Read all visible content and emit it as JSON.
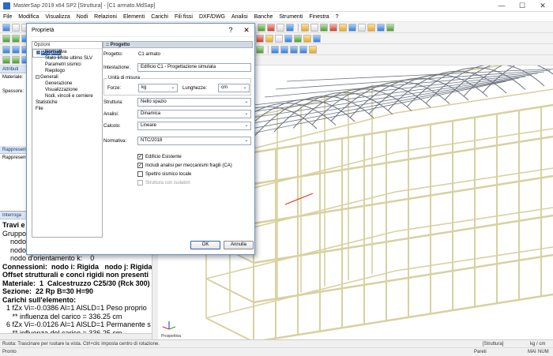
{
  "window": {
    "title": "MasterSap 2019 x64 SP2 [Struttura] - [C1 armato.MdSap]",
    "controls": {
      "minimize": "—",
      "maximize": "☐",
      "close": "✕"
    }
  },
  "menu": [
    "File",
    "Modifica",
    "Visualizza",
    "Nodi",
    "Relazioni",
    "Elementi",
    "Carichi",
    "Fili fissi",
    "DXF/DWG",
    "Analisi",
    "Banche",
    "Strumenti",
    "Finestra",
    "?"
  ],
  "panels": {
    "attributi": "Attributi",
    "materiale": "Materiale:",
    "spessore": "Spessore:",
    "rappresentazione_head": "Rappresent",
    "rappresentazione": "Rappresenta",
    "interroga": "Interroga"
  },
  "interroga_lines": [
    {
      "text": "Travi e p",
      "bold": true
    },
    {
      "text": "Gruppo:",
      "bold": false
    },
    {
      "text": "    nodo",
      "bold": false
    },
    {
      "text": "    nodo",
      "bold": false
    },
    {
      "text": "    nodo d'orientamento k:    0",
      "bold": false
    },
    {
      "text": "Connessioni:  nodo i: Rigida   nodo j: Rigida",
      "bold": true
    },
    {
      "text": "Offset strutturali e conci rigidi non presenti",
      "bold": true
    },
    {
      "text": "Materiale:  1  Calcestruzzo C25/30 (Rck 300)",
      "bold": true
    },
    {
      "text": "Sezione:  22 Rp B=30 H=90",
      "bold": true
    },
    {
      "text": "Carichi sull'elemento:",
      "bold": true
    },
    {
      "text": "  1 fZx Vi=-0.0386 Al=1 AlSLD=1 Peso proprio",
      "bold": false
    },
    {
      "text": "     ** influenza del carico = 336.25 cm",
      "bold": false
    },
    {
      "text": "  6 fZx Vi=-0.0126 Al=1 AlSLD=1 Permanente s",
      "bold": false
    },
    {
      "text": "     ** influenza del carico = 336.25 cm",
      "bold": false
    }
  ],
  "dialog": {
    "title": "Proprietà",
    "help": "?",
    "close": "✕",
    "options_label": "Opzioni",
    "tree": [
      {
        "label": "Progetto",
        "level": 0,
        "expander": "−",
        "selected": true
      },
      {
        "label": "Normativa",
        "level": 1
      },
      {
        "label": "Stato limite ultimo SLV",
        "level": 1
      },
      {
        "label": "Parametri sismici",
        "level": 1
      },
      {
        "label": "Riepilogo",
        "level": 1
      },
      {
        "label": "Generali",
        "level": 0,
        "expander": "−"
      },
      {
        "label": "Generazione",
        "level": 1
      },
      {
        "label": "Visualizzazione",
        "level": 1
      },
      {
        "label": "Nodi, vincoli e cerniere",
        "level": 1
      },
      {
        "label": "Statistiche",
        "level": 0
      },
      {
        "label": "File",
        "level": 0
      }
    ],
    "section": ":: Progetto",
    "progetto_label": "Progetto:",
    "progetto_value": "C1 armato",
    "intestazione_label": "Intestazione:",
    "intestazione_value": "Edificio C1 - Progettazione simulata",
    "unita_label": "Unità di misura",
    "forze_label": "Forze:",
    "forze_value": "kg",
    "lunghezze_label": "Lunghezze:",
    "lunghezze_value": "cm",
    "struttura_label": "Struttura:",
    "struttura_value": "Nello spazio",
    "analisi_label": "Analisi:",
    "analisi_value": "Dinamica",
    "calcolo_label": "Calcolo:",
    "calcolo_value": "Lineare",
    "normativa_label": "Normativa:",
    "normativa_value": "NTC/2018",
    "checks": [
      {
        "label": "Edificio Esistente",
        "checked": true,
        "disabled": false
      },
      {
        "label": "Includi analisi per meccanismi fragili (CA)",
        "checked": true,
        "disabled": false
      },
      {
        "label": "Spettro sismico locale",
        "checked": false,
        "disabled": false
      },
      {
        "label": "Struttura con isolatori",
        "checked": false,
        "disabled": true
      }
    ],
    "ok": "OK",
    "cancel": "Annulla"
  },
  "viewport": {
    "axes_label": "Prospettiva",
    "bg": "#ffffff",
    "frame_color": "#d8d1a0",
    "roof_color": "#6a7280"
  },
  "status": {
    "hint": "Ruota: Trascinare per ruotare la vista. Ctrl+clic imposta centro di rotazione.",
    "pronto": "Pronto",
    "pareti": "Pareti",
    "struttura": "[Struttura]",
    "units": "kg / cm",
    "mai": "MAI",
    "num": "NUM"
  }
}
